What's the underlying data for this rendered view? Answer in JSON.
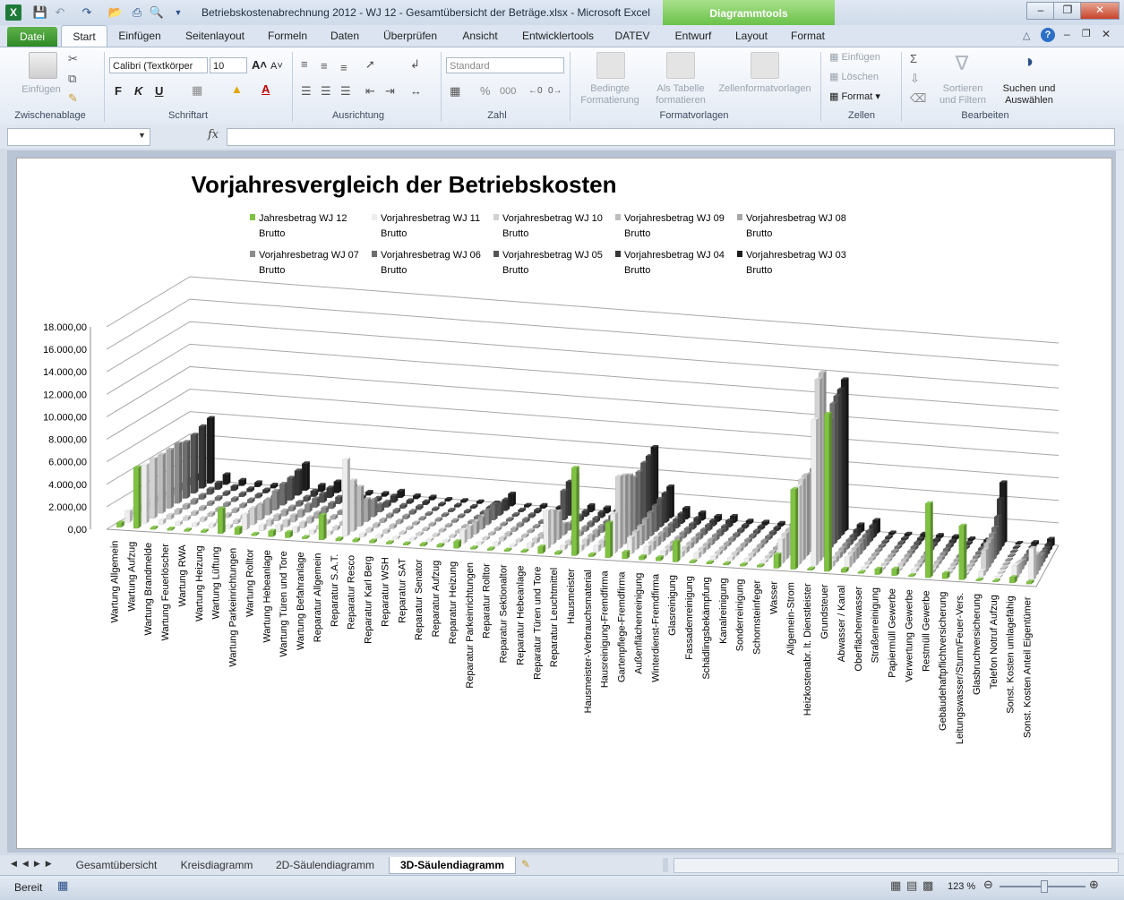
{
  "window": {
    "title": "Betriebskostenabrechnung 2012 - WJ 12 - Gesamtübersicht der Beträge.xlsx  -  Microsoft Excel",
    "context_tab": "Diagrammtools",
    "app_icon": "X"
  },
  "tabs": {
    "file": "Datei",
    "items": [
      "Start",
      "Einfügen",
      "Seitenlayout",
      "Formeln",
      "Daten",
      "Überprüfen",
      "Ansicht",
      "Entwicklertools",
      "DATEV",
      "Entwurf",
      "Layout",
      "Format"
    ]
  },
  "ribbon": {
    "clipboard": {
      "paste": "Einfügen",
      "label": "Zwischenablage"
    },
    "font": {
      "name": "Calibri (Textkörper",
      "size": "10",
      "bold": "F",
      "italic": "K",
      "underline": "U",
      "label": "Schriftart"
    },
    "alignment": {
      "label": "Ausrichtung"
    },
    "number": {
      "format": "Standard",
      "percent": "%",
      "thousands": "000",
      "label": "Zahl"
    },
    "styles": {
      "conditional_1": "Bedingte",
      "conditional_2": "Formatierung",
      "table_1": "Als Tabelle",
      "table_2": "formatieren",
      "cell_styles": "Zellenformatvorlagen",
      "label": "Formatvorlagen"
    },
    "cells": {
      "insert": "Einfügen",
      "delete": "Löschen",
      "format": "Format",
      "label": "Zellen"
    },
    "editing": {
      "sort_1": "Sortieren",
      "sort_2": "und Filtern",
      "find_1": "Suchen und",
      "find_2": "Auswählen",
      "label": "Bearbeiten"
    }
  },
  "formula_bar": {
    "fx": "fx",
    "name_box": "",
    "content": ""
  },
  "sheet_tabs": [
    "Gesamtübersicht",
    "Kreisdiagramm",
    "2D-Säulendiagramm",
    "3D-Säulendiagramm"
  ],
  "active_sheet": "3D-Säulendiagramm",
  "status": {
    "ready": "Bereit",
    "zoom": "123 %"
  },
  "chart_data": {
    "type": "bar",
    "title": "Vorjahresvergleich der Betriebskosten",
    "ylim": [
      0,
      18000
    ],
    "yticks": [
      "0,00",
      "2.000,00",
      "4.000,00",
      "6.000,00",
      "8.000,00",
      "10.000,00",
      "12.000,00",
      "14.000,00",
      "16.000,00",
      "18.000,00"
    ],
    "grid": true,
    "legend_position": "top",
    "categories": [
      "Wartung Allgemein",
      "Wartung Aufzug",
      "Wartung Brandmelde",
      "Wartung Feuerlöscher",
      "Wartung RWA",
      "Wartung Heizung",
      "Wartung Lüftung",
      "Wartung Parkeinrichtungen",
      "Wartung Rolltor",
      "Wartung Hebeanlage",
      "Wartung Türen und Tore",
      "Wartung Befahranlage",
      "Reparatur Allgemein",
      "Reparatur S.A.T.",
      "Reparatur Resco",
      "Reparatur Karl Berg",
      "Reparatur WSH",
      "Reparatur SAT",
      "Reparatur Senator",
      "Reparatur Aufzug",
      "Reparatur Heizung",
      "Reparatur Parkeinrichtungen",
      "Reparatur Rolltor",
      "Reparatur Sektionaltor",
      "Reparatur Hebeanlage",
      "Reparatur Türen und Tore",
      "Reparatur Leuchtmittel",
      "Hausmeister",
      "Hausmeister-Verbrauchsmaterial",
      "Hausreinigung-Fremdfirma",
      "Gartenpflege-Fremdfirma",
      "Außenflächenreinigung",
      "Winterdienst-Fremdfirma",
      "Glasreinigung",
      "Fassadenreinigung",
      "Schädlingsbekämpfung",
      "Kanalreinigung",
      "Sonderreinigung",
      "Schornsteinfeger",
      "Wasser",
      "Allgemein-Strom",
      "Heizkostenabr. lt. Dienstleister",
      "Grundsteuer",
      "Abwasser / Kanal",
      "Oberflächenwasser",
      "Straßenreinigung",
      "Papiermüll Gewerbe",
      "Verwertung Gewerbe",
      "Restmüll Gewerbe",
      "Gebäudehaftpflichtversicherung",
      "Leitungswasser/Sturm/Feuer-Vers.",
      "Glasbruchversicherung",
      "Telefon Notruf Aufzug",
      "Sonst. Kosten umlagefähig",
      "Sonst. Kosten Anteil Eigentümer"
    ],
    "series": [
      {
        "name": "Jahresbetrag WJ 12 Brutto",
        "color": "#7fc241",
        "values": [
          400,
          5400,
          150,
          150,
          150,
          150,
          2200,
          600,
          150,
          500,
          500,
          150,
          2200,
          200,
          200,
          200,
          150,
          150,
          200,
          200,
          600,
          150,
          150,
          150,
          150,
          600,
          200,
          7800,
          200,
          3100,
          600,
          300,
          300,
          1800,
          150,
          150,
          150,
          150,
          150,
          1200,
          7100,
          150,
          14000,
          300,
          100,
          500,
          600,
          100,
          6600,
          500,
          4800,
          100,
          100,
          500,
          200
        ]
      },
      {
        "name": "Vorjahresbetrag WJ 11 Brutto",
        "color": "#ededed",
        "values": [
          1000,
          5200,
          400,
          300,
          300,
          300,
          300,
          1400,
          500,
          600,
          500,
          300,
          300,
          6800,
          300,
          300,
          200,
          200,
          200,
          200,
          1200,
          200,
          300,
          200,
          400,
          3400,
          400,
          500,
          600,
          3500,
          1500,
          800,
          500,
          500,
          500,
          300,
          300,
          300,
          200,
          2200,
          7000,
          13000,
          500,
          1000,
          200,
          200,
          200,
          300,
          300,
          200,
          200,
          500,
          100,
          1200,
          2800
        ]
      },
      {
        "name": "Vorjahresbetrag WJ 10 Brutto",
        "color": "#d2d2d2",
        "values": [
          900,
          5300,
          400,
          300,
          300,
          300,
          300,
          1500,
          500,
          600,
          500,
          300,
          300,
          4500,
          300,
          300,
          200,
          200,
          200,
          200,
          1100,
          200,
          300,
          200,
          400,
          3000,
          400,
          600,
          600,
          6400,
          1600,
          800,
          500,
          500,
          500,
          300,
          300,
          300,
          200,
          2300,
          7200,
          16200,
          500,
          1000,
          200,
          200,
          300,
          300,
          300,
          200,
          200,
          2000,
          100,
          1000,
          1800
        ]
      },
      {
        "name": "Vorjahresbetrag WJ 09 Brutto",
        "color": "#bdbdbd",
        "values": [
          800,
          5200,
          400,
          300,
          300,
          300,
          300,
          1400,
          500,
          600,
          500,
          300,
          300,
          3500,
          300,
          300,
          200,
          200,
          200,
          200,
          1100,
          200,
          300,
          200,
          400,
          2500,
          400,
          600,
          600,
          6100,
          1700,
          800,
          500,
          500,
          500,
          300,
          300,
          300,
          200,
          2300,
          7200,
          16400,
          500,
          1000,
          200,
          200,
          300,
          300,
          300,
          200,
          200,
          2200,
          100,
          800,
          1600
        ]
      },
      {
        "name": "Vorjahresbetrag WJ 08 Brutto",
        "color": "#a8a8a8",
        "values": [
          800,
          5200,
          400,
          300,
          300,
          300,
          300,
          1400,
          500,
          600,
          500,
          300,
          300,
          2000,
          300,
          300,
          200,
          200,
          200,
          200,
          1100,
          200,
          300,
          200,
          400,
          1000,
          400,
          600,
          600,
          5700,
          1900,
          800,
          500,
          500,
          500,
          300,
          300,
          300,
          200,
          2400,
          6900,
          11000,
          500,
          1000,
          200,
          200,
          300,
          300,
          300,
          200,
          200,
          2200,
          100,
          500,
          1000
        ]
      },
      {
        "name": "Vorjahresbetrag WJ 07 Brutto",
        "color": "#8c8c8c",
        "values": [
          800,
          5300,
          400,
          300,
          300,
          300,
          300,
          1700,
          400,
          700,
          500,
          300,
          300,
          1500,
          300,
          300,
          200,
          200,
          200,
          200,
          1300,
          200,
          300,
          200,
          400,
          600,
          400,
          600,
          600,
          5100,
          2100,
          800,
          500,
          500,
          500,
          300,
          300,
          300,
          200,
          2300,
          7000,
          11500,
          500,
          1000,
          200,
          200,
          300,
          300,
          300,
          200,
          200,
          2300,
          100,
          400,
          800
        ]
      },
      {
        "name": "Vorjahresbetrag WJ 06 Brutto",
        "color": "#6e6e6e",
        "values": [
          700,
          5000,
          400,
          300,
          300,
          300,
          300,
          1900,
          400,
          800,
          500,
          300,
          300,
          700,
          300,
          300,
          200,
          200,
          200,
          200,
          1400,
          200,
          300,
          200,
          500,
          500,
          400,
          600,
          600,
          5200,
          2300,
          800,
          500,
          500,
          500,
          300,
          300,
          300,
          200,
          2300,
          6600,
          12500,
          500,
          1000,
          200,
          200,
          300,
          300,
          300,
          200,
          200,
          2500,
          100,
          300,
          700
        ]
      },
      {
        "name": "Vorjahresbetrag WJ 05 Brutto",
        "color": "#545454",
        "values": [
          700,
          5200,
          500,
          300,
          300,
          300,
          300,
          2000,
          400,
          800,
          600,
          300,
          300,
          500,
          300,
          300,
          200,
          200,
          200,
          200,
          1100,
          200,
          300,
          200,
          2600,
          500,
          400,
          700,
          600,
          5600,
          2500,
          800,
          500,
          500,
          500,
          300,
          300,
          300,
          200,
          2400,
          6800,
          12800,
          500,
          1000,
          200,
          200,
          300,
          300,
          300,
          200,
          200,
          3100,
          100,
          300,
          600
        ]
      },
      {
        "name": "Vorjahresbetrag WJ 04 Brutto",
        "color": "#363636",
        "values": [
          700,
          5500,
          600,
          400,
          300,
          300,
          300,
          2200,
          500,
          900,
          700,
          300,
          300,
          600,
          300,
          300,
          200,
          200,
          200,
          200,
          1000,
          200,
          300,
          200,
          3000,
          500,
          500,
          800,
          700,
          5800,
          2600,
          900,
          600,
          500,
          600,
          300,
          300,
          300,
          300,
          2500,
          6800,
          13000,
          600,
          1100,
          200,
          200,
          300,
          300,
          300,
          200,
          200,
          4300,
          100,
          300,
          600
        ]
      },
      {
        "name": "Vorjahresbetrag WJ 03 Brutto",
        "color": "#1c1c1c",
        "values": [
          600,
          5800,
          900,
          500,
          400,
          300,
          300,
          2400,
          600,
          1000,
          700,
          300,
          300,
          600,
          300,
          300,
          200,
          200,
          200,
          200,
          1100,
          200,
          300,
          200,
          3200,
          600,
          500,
          800,
          700,
          6200,
          2800,
          1000,
          700,
          500,
          600,
          300,
          300,
          300,
          300,
          2600,
          7000,
          13500,
          700,
          1200,
          200,
          200,
          300,
          300,
          300,
          200,
          200,
          5400,
          100,
          300,
          700
        ]
      }
    ]
  }
}
